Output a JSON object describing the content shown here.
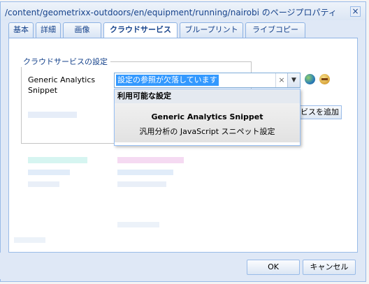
{
  "window": {
    "title": "/content/geometrixx-outdoors/en/equipment/running/nairobi のページプロパティ",
    "close_symbol": "×"
  },
  "tabs": [
    {
      "label": "基本",
      "active": false
    },
    {
      "label": "詳細",
      "active": false
    },
    {
      "label": "画像",
      "active": false
    },
    {
      "label": "クラウドサービス",
      "active": true
    },
    {
      "label": "ブループリント",
      "active": false
    },
    {
      "label": "ライブコピー",
      "active": false
    }
  ],
  "cloud_settings": {
    "legend": "クラウドサービスの設定",
    "field_label": "Generic Analytics Snippet",
    "combo_value": "設定の参照が欠落しています",
    "clear_symbol": "×",
    "trigger_symbol": "▼",
    "add_button_label": "ビスを追加"
  },
  "dropdown": {
    "header": "利用可能な設定",
    "item_title": "Generic Analytics Snippet",
    "item_description": "汎用分析の JavaScript スニペット設定"
  },
  "footer": {
    "ok_label": "OK",
    "cancel_label": "キャンセル"
  }
}
